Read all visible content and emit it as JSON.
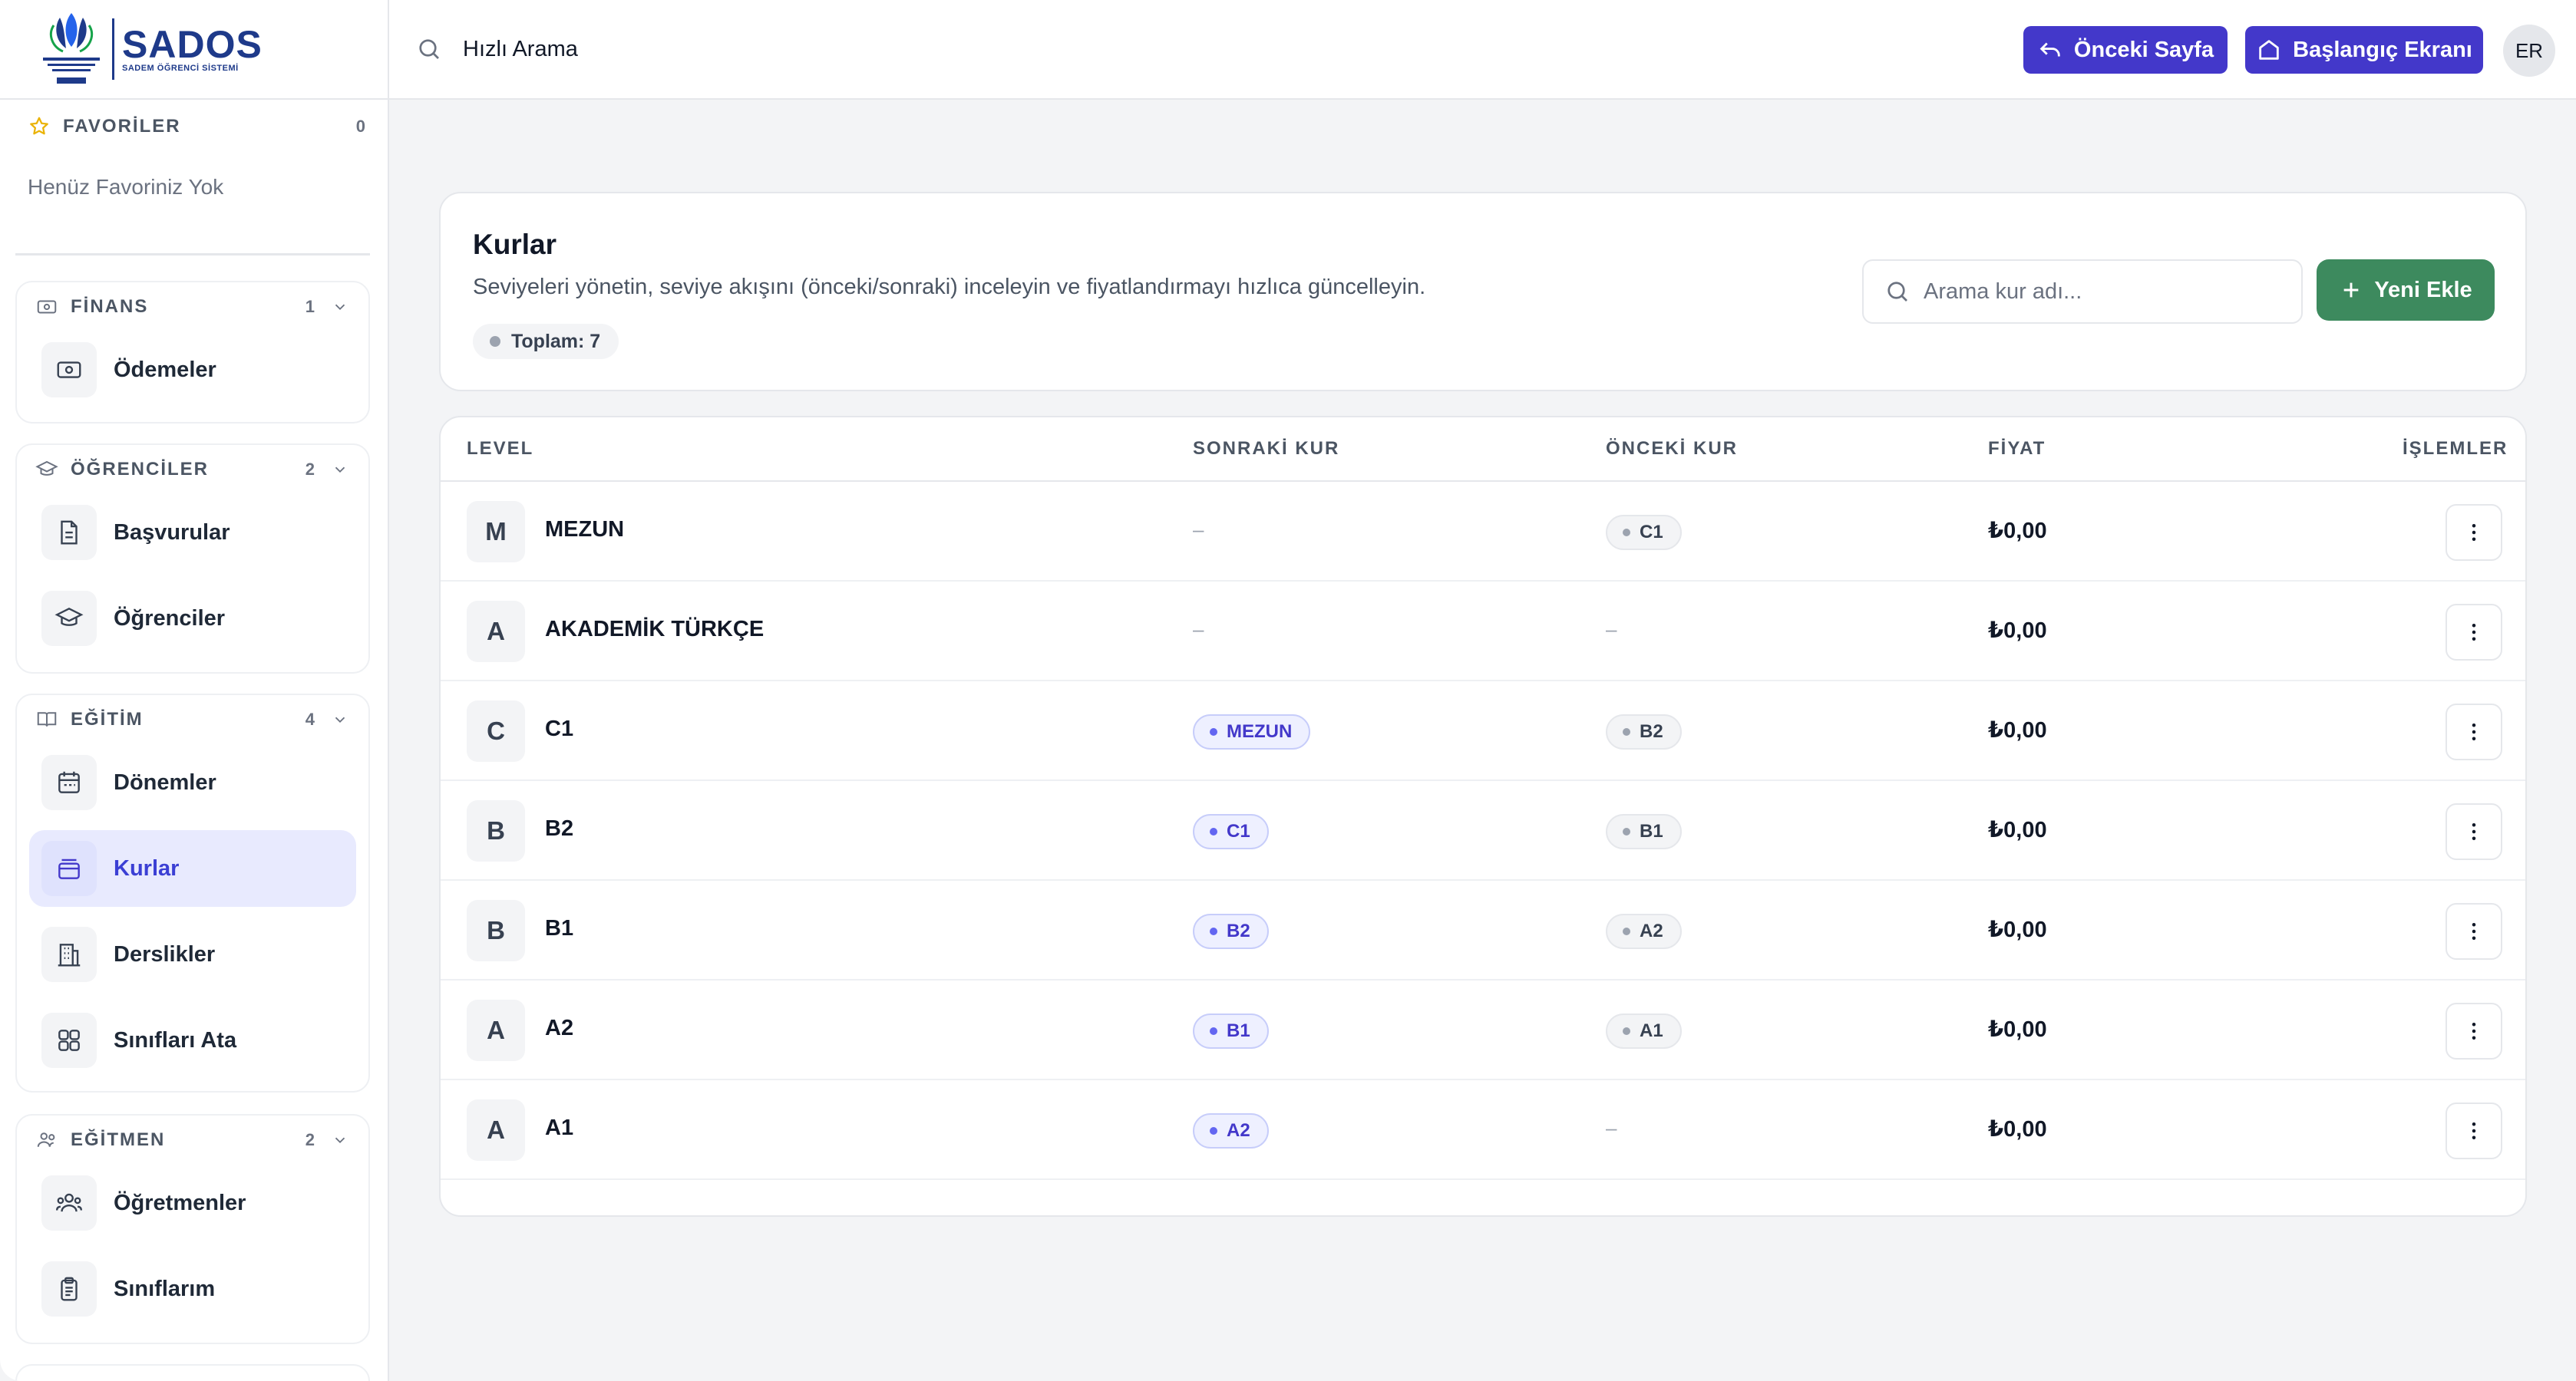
{
  "brand": {
    "name": "SADOS",
    "subtitle": "SADEM ÖĞRENCİ SİSTEMİ"
  },
  "topbar": {
    "search_label": "Hızlı Arama",
    "prev_button": "Önceki Sayfa",
    "home_button": "Başlangıç Ekranı",
    "avatar_initials": "ER"
  },
  "sidebar": {
    "favorites": {
      "label": "FAVORİLER",
      "count": "0",
      "empty_text": "Henüz Favoriniz Yok"
    },
    "groups": [
      {
        "label": "FİNANS",
        "count": "1",
        "items": [
          {
            "label": "Ödemeler",
            "icon": "money-icon"
          }
        ]
      },
      {
        "label": "ÖĞRENCİLER",
        "count": "2",
        "items": [
          {
            "label": "Başvurular",
            "icon": "document-icon"
          },
          {
            "label": "Öğrenciler",
            "icon": "graduation-cap-icon"
          }
        ]
      },
      {
        "label": "EĞİTİM",
        "count": "4",
        "items": [
          {
            "label": "Dönemler",
            "icon": "calendar-icon"
          },
          {
            "label": "Kurlar",
            "icon": "layers-icon",
            "active": true
          },
          {
            "label": "Derslikler",
            "icon": "building-icon"
          },
          {
            "label": "Sınıfları Ata",
            "icon": "grid-icon"
          }
        ]
      },
      {
        "label": "EĞİTMEN",
        "count": "2",
        "items": [
          {
            "label": "Öğretmenler",
            "icon": "users-icon"
          },
          {
            "label": "Sınıflarım",
            "icon": "clipboard-icon"
          }
        ]
      }
    ]
  },
  "header": {
    "title": "Kurlar",
    "description": "Seviyeleri yönetin, seviye akışını (önceki/sonraki) inceleyin ve fiyatlandırmayı hızlıca güncelleyin.",
    "total_label": "Toplam: 7",
    "search_placeholder": "Arama kur adı...",
    "add_button": "Yeni Ekle"
  },
  "table": {
    "columns": {
      "level": "LEVEL",
      "next": "SONRAKİ KUR",
      "prev": "ÖNCEKİ KUR",
      "price": "FİYAT",
      "actions": "İŞLEMLER"
    },
    "empty_marker": "–",
    "rows": [
      {
        "initial": "M",
        "name": "MEZUN",
        "next": "",
        "prev": "C1",
        "price": "₺0,00"
      },
      {
        "initial": "A",
        "name": "AKADEMİK TÜRKÇE",
        "next": "",
        "prev": "",
        "price": "₺0,00"
      },
      {
        "initial": "C",
        "name": "C1",
        "next": "MEZUN",
        "prev": "B2",
        "price": "₺0,00"
      },
      {
        "initial": "B",
        "name": "B2",
        "next": "C1",
        "prev": "B1",
        "price": "₺0,00"
      },
      {
        "initial": "B",
        "name": "B1",
        "next": "B2",
        "prev": "A2",
        "price": "₺0,00"
      },
      {
        "initial": "A",
        "name": "A2",
        "next": "B1",
        "prev": "A1",
        "price": "₺0,00"
      },
      {
        "initial": "A",
        "name": "A1",
        "next": "A2",
        "prev": "",
        "price": "₺0,00"
      }
    ]
  },
  "colors": {
    "primary": "#4338ca",
    "success": "#3d8a5e",
    "active_bg": "#e8eafe"
  }
}
